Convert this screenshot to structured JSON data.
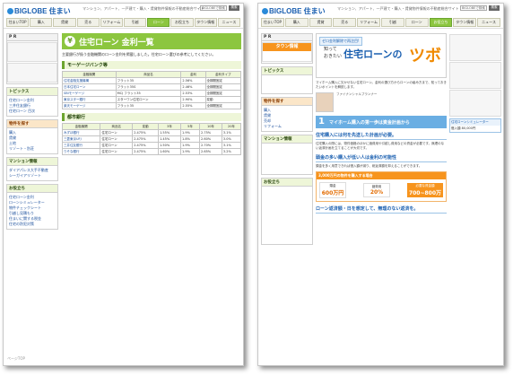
{
  "brand": "BIGLOBE 住まい",
  "header": {
    "note": "マンション、アパート、一戸建て・購入・賃貸物件情報の不動産総合サイト",
    "search_placeholder": "BIGLOBEで検索",
    "search_button": "検索"
  },
  "nav": [
    "住まいTOP",
    "購入",
    "賃貸",
    "売る",
    "リフォーム",
    "引越",
    "引越し",
    "ローン",
    "お役立ち",
    "タウン情報",
    "ニュース"
  ],
  "left": {
    "sidebar": {
      "pr": "P R",
      "topics": "トピックス",
      "topics_items": [
        "住宅ローン金利",
        "三井住友銀行",
        "住宅ローン 目次"
      ],
      "search_title": "物件を探す",
      "search_items": [
        "購入",
        "賃貸",
        "土地",
        "リゾート・別荘"
      ],
      "mansion_title": "マンション情報",
      "mansion_items": [
        "ダイアパレス大手不動産",
        "シーガイアリゾート"
      ],
      "bottom_title": "お役立ち",
      "bottom_items": [
        "住宅ローン金利",
        "ローンシミュレーター",
        "物件チェックシート",
        "引越し見積もり",
        "住まいに関する税金",
        "住宅の防犯対策"
      ],
      "footer": "ページTOP"
    },
    "main": {
      "title": "住宅ローン 金利一覧",
      "intro": "主要銀行が扱う金融機関のローン金利を掲載しました。住宅ローン選びの参考にしてください。",
      "section1": "モーゲージバンク等",
      "table1_headers": [
        "金融機関",
        "商品名",
        "金利",
        "金利タイプ"
      ],
      "table1_rows": [
        [
          "住宅金融支援機構",
          "フラット35",
          "2.56%",
          "全期間固定"
        ],
        [
          "日本住宅ローン",
          "フラット35S",
          "2.46%",
          "全期間固定"
        ],
        [
          "SBIモーゲージ",
          "MCJ フラット35",
          "2.53%",
          "全期間固定"
        ],
        [
          "東京スター銀行",
          "スターワン住宅ローン",
          "2.90%",
          "変動"
        ],
        [
          "楽天モーゲージ",
          "フラット35",
          "2.55%",
          "全期間固定"
        ]
      ],
      "section2": "都市銀行",
      "table2_headers": [
        "金融機関",
        "商品名",
        "変動",
        "3年",
        "5年",
        "10年",
        "20年"
      ],
      "table2_rows": [
        [
          "みずほ銀行",
          "住宅ローン",
          "2.475%",
          "1.55%",
          "1.9%",
          "2.75%",
          "3.1%"
        ],
        [
          "三菱東京UFJ",
          "住宅ローン",
          "2.475%",
          "1.45%",
          "1.8%",
          "2.60%",
          "3.0%"
        ],
        [
          "三井住友銀行",
          "住宅ローン",
          "2.475%",
          "1.50%",
          "1.9%",
          "2.70%",
          "3.1%"
        ],
        [
          "りそな銀行",
          "住宅ローン",
          "2.475%",
          "1.60%",
          "1.9%",
          "2.65%",
          "3.2%"
        ]
      ]
    }
  },
  "right": {
    "sidebar": {
      "pr": "P R",
      "town": "タウン情報",
      "topics": "トピックス",
      "search_title": "物件を探す",
      "search_items": [
        "購入",
        "賃貸",
        "売却",
        "リフォーム"
      ],
      "mansion_title": "マンション情報",
      "other_title": "お役立ち"
    },
    "hero": {
      "band": "ゼロ金利解除で再注目!",
      "line1": "知って",
      "line2": "おきたい",
      "big": "住宅ローンの",
      "tsubo": "ツボ"
    },
    "lead": "マイホーム購入に欠かせない住宅ローン。金利の選び方からローンの組み方まで、知っておきたいポイントを解説します。",
    "person_caption": "ファイナンシャルプランナー",
    "chapter_num": "1",
    "chapter_title": "マイホーム購入の第一歩は資金計画から",
    "h2a": "住宅購入には何を先送した計画が必要。",
    "para_a": "住宅購入の際には、物件価格のほかに諸費用や引越し費用などの資金が必要です。無理のない返済計画を立てることが大切です。",
    "h2b": "頭金の多い購入が低い人は金利の可能性",
    "para_b": "頭金を多く用意できれば借入額が減り、総返済額を抑えることができます。",
    "funds": {
      "title": "3,000万円の物件を購入する場合",
      "c1_label": "頭金",
      "c1_value": "600万円",
      "c2_label": "諸費用",
      "c2_value": "20%",
      "result_label": "必要な資金額",
      "result_value": "700~800万"
    },
    "h2c": "ローン返済額・日を想定して、無理のない返済を。",
    "calc_title": "住宅ローンシミュレーター",
    "calc_label": "借入額",
    "calc_value": "80,000円"
  }
}
